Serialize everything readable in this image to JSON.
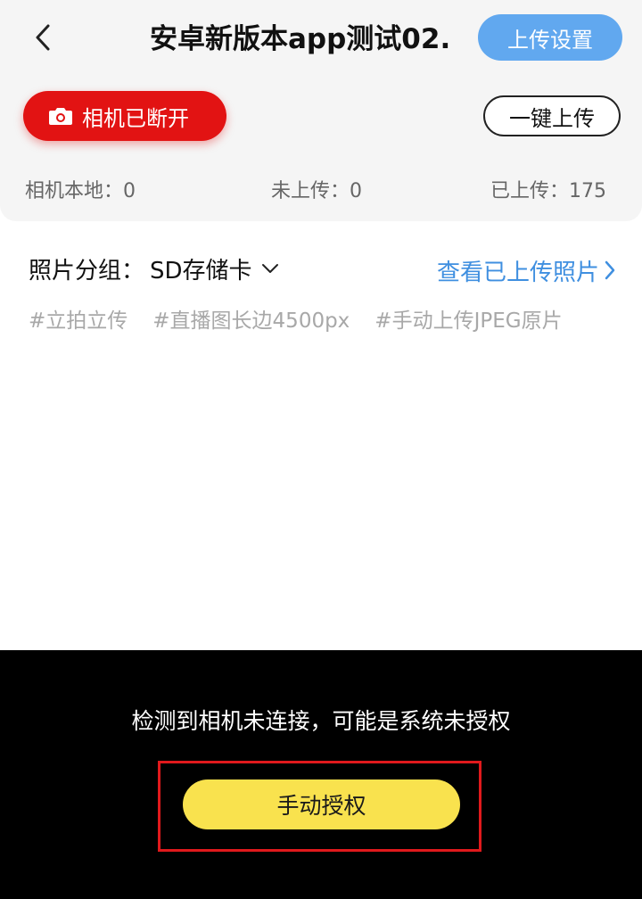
{
  "header": {
    "back_icon": "chevron-left-icon",
    "title": "安卓新版本app测试02.",
    "upload_settings_label": "上传设置"
  },
  "camera": {
    "status_label": "相机已断开",
    "icon": "camera-icon",
    "status_color": "#e21313"
  },
  "one_click_upload_label": "一键上传",
  "stats": {
    "local": "相机本地：0",
    "pending": "未上传：0",
    "uploaded": "已上传：175"
  },
  "group": {
    "label": "照片分组：",
    "value": "SD存储卡",
    "view_uploaded_label": "查看已上传照片"
  },
  "tags": [
    "#立拍立传",
    "#直播图长边4500px",
    "#手动上传JPEG原片"
  ],
  "overlay": {
    "notice": "检测到相机未连接，可能是系统未授权",
    "auth_button_label": "手动授权",
    "auth_button_color": "#f9e24e",
    "highlight_color": "#e0191c"
  },
  "colors": {
    "accent_blue": "#61a8ef",
    "link_blue": "#3f8fe0"
  }
}
